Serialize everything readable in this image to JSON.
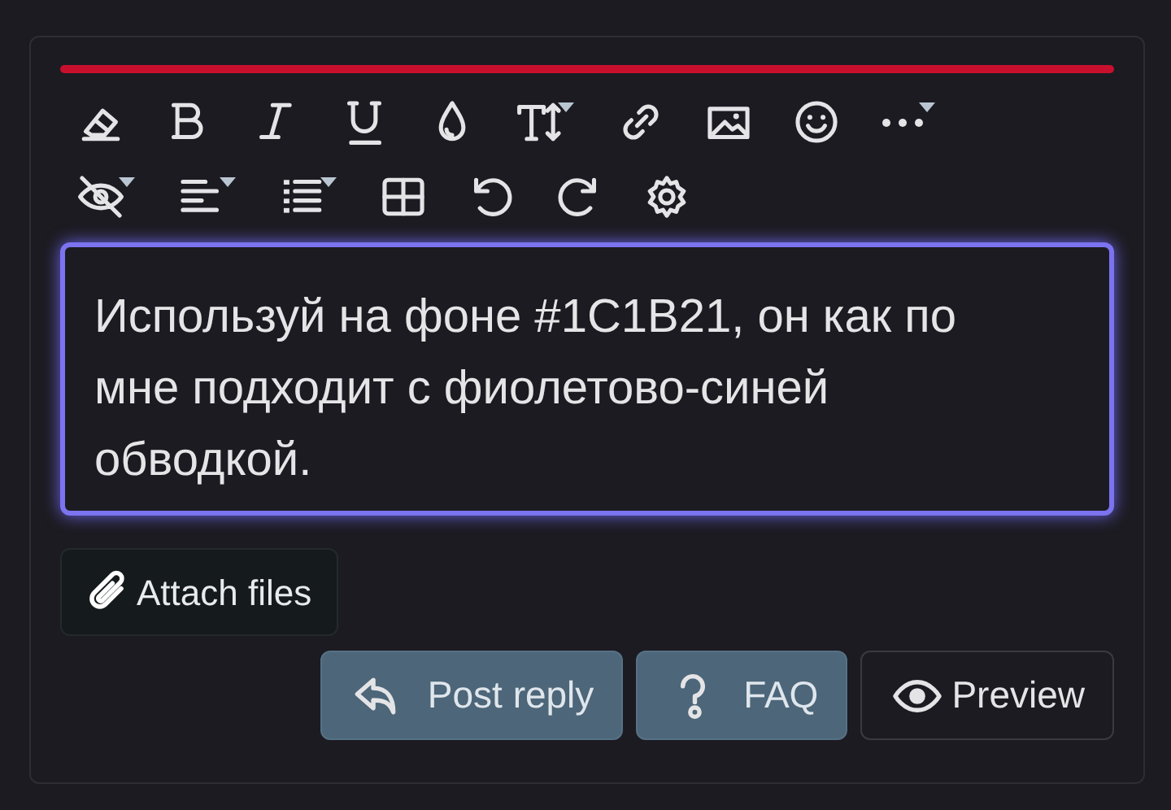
{
  "toolbar": {
    "rows": [
      [
        {
          "kind": "eraser",
          "dropdown": false
        },
        {
          "kind": "bold",
          "dropdown": false
        },
        {
          "kind": "italic",
          "dropdown": false
        },
        {
          "kind": "underline",
          "dropdown": false
        },
        {
          "kind": "color",
          "dropdown": false
        },
        {
          "kind": "size",
          "dropdown": true
        },
        {
          "kind": "link",
          "dropdown": false
        },
        {
          "kind": "image",
          "dropdown": false
        },
        {
          "kind": "smiley",
          "dropdown": false
        },
        {
          "kind": "more",
          "dropdown": true
        }
      ],
      [
        {
          "kind": "hide",
          "dropdown": true
        },
        {
          "kind": "align",
          "dropdown": true
        },
        {
          "kind": "list",
          "dropdown": true
        },
        {
          "kind": "table",
          "dropdown": false
        },
        {
          "kind": "undo",
          "dropdown": false
        },
        {
          "kind": "redo",
          "dropdown": false
        },
        {
          "kind": "settings",
          "dropdown": false
        }
      ]
    ]
  },
  "editor": {
    "value": "Используй на фоне #1C1B21, он как по мне подходит с фиолетово-синей обводкой.",
    "focused": true
  },
  "attach_button": {
    "label": "Attach files"
  },
  "actions": [
    {
      "kind": "post",
      "label": "Post reply"
    },
    {
      "kind": "faq",
      "label": "FAQ"
    },
    {
      "kind": "preview",
      "label": "Preview"
    }
  ]
}
